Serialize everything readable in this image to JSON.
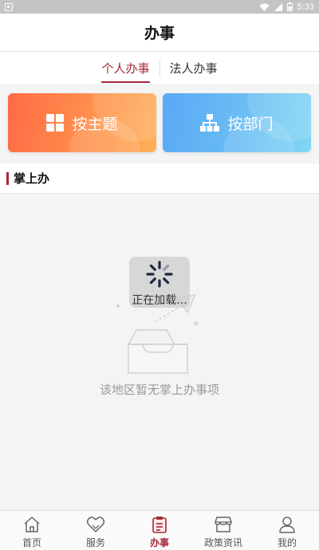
{
  "status_bar": {
    "time": "5:33"
  },
  "header": {
    "title": "办事"
  },
  "tabs": [
    {
      "label": "个人办事",
      "active": true
    },
    {
      "label": "法人办事",
      "active": false
    }
  ],
  "cards": {
    "theme": {
      "label": "按主题",
      "icon": "grid-icon"
    },
    "department": {
      "label": "按部门",
      "icon": "org-chart-icon"
    }
  },
  "section": {
    "title": "掌上办"
  },
  "loading": {
    "text": "正在加载..."
  },
  "empty": {
    "text": "该地区暂无掌上办事项",
    "icon": "empty-tray-icon"
  },
  "bottom_nav": [
    {
      "label": "首页",
      "icon": "home-icon",
      "active": false
    },
    {
      "label": "服务",
      "icon": "heart-tag-icon",
      "active": false
    },
    {
      "label": "办事",
      "icon": "clipboard-icon",
      "active": true
    },
    {
      "label": "政策资讯",
      "icon": "store-icon",
      "active": false
    },
    {
      "label": "我的",
      "icon": "user-icon",
      "active": false
    }
  ],
  "colors": {
    "accent": "#a8283a",
    "theme_card": "#ff7a48",
    "dept_card": "#64b4f4"
  }
}
